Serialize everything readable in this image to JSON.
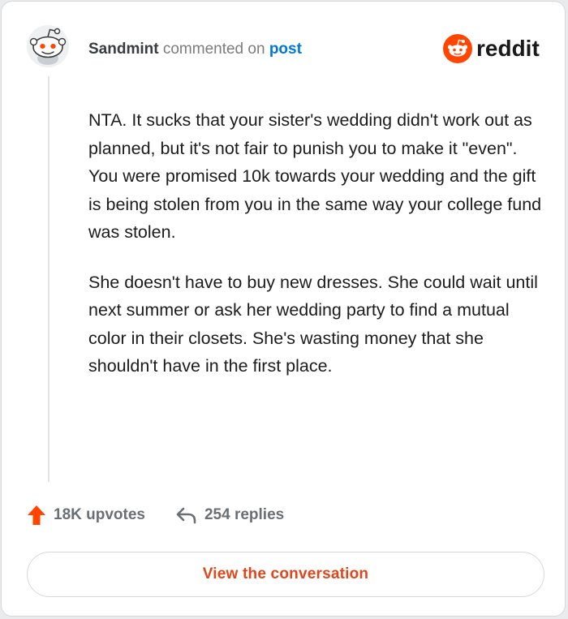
{
  "header": {
    "username": "Sandmint",
    "commented_text": "commented on",
    "post_link": "post",
    "brand": "reddit",
    "brand_color": "#ff4500"
  },
  "comment": {
    "paragraphs": [
      "NTA. It sucks that your sister's wedding didn't work out as planned, but it's not fair to punish you to make it \"even\". You were promised 10k towards your wedding and the gift is being stolen from you in the same way your college fund was stolen.",
      "She doesn't have to buy new dresses. She could wait until next summer or ask her wedding party to find a mutual color in their closets. She's wasting money that she shouldn't have in the first place."
    ]
  },
  "stats": {
    "upvotes": "18K upvotes",
    "replies": "254 replies",
    "upvote_icon": "arrow-up-icon",
    "reply_icon": "reply-arrow-icon"
  },
  "cta": {
    "label": "View the conversation",
    "color": "#e0461a"
  }
}
